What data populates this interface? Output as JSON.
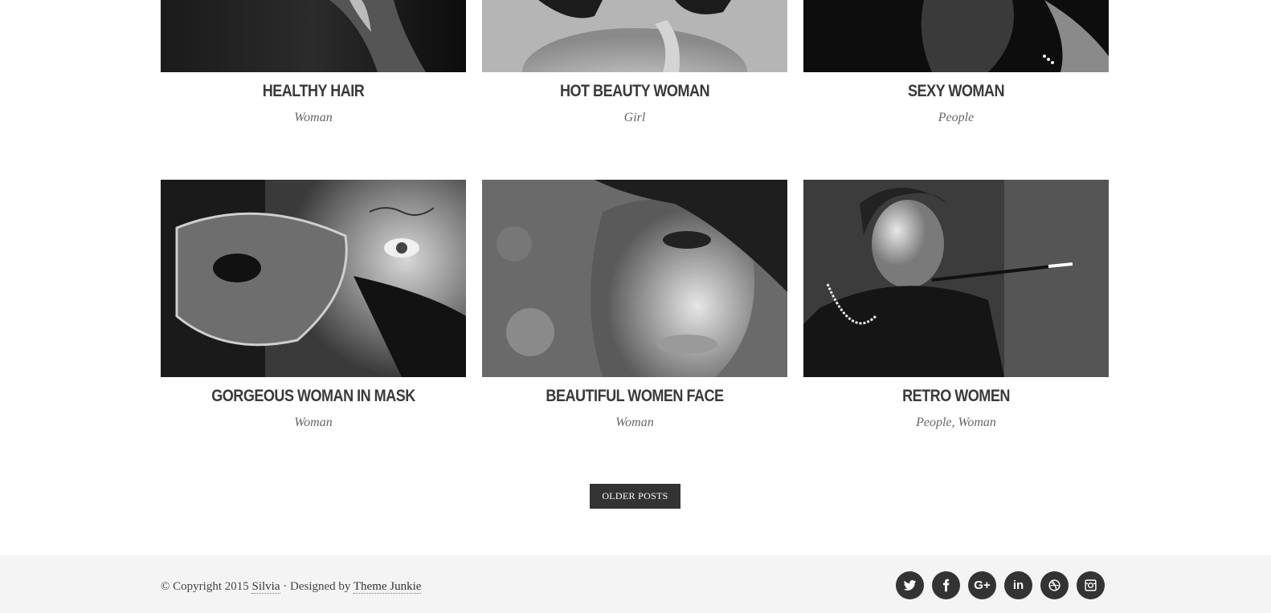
{
  "posts": [
    {
      "title": "HEALTHY HAIR",
      "categories": [
        "Woman"
      ]
    },
    {
      "title": "HOT BEAUTY WOMAN",
      "categories": [
        "Girl"
      ]
    },
    {
      "title": "SEXY WOMAN",
      "categories": [
        "People"
      ]
    },
    {
      "title": "GORGEOUS WOMAN IN MASK",
      "categories": [
        "Woman"
      ]
    },
    {
      "title": "BEAUTIFUL WOMEN FACE",
      "categories": [
        "Woman"
      ]
    },
    {
      "title": "RETRO WOMEN",
      "categories": [
        "People",
        "Woman"
      ]
    }
  ],
  "pagination": {
    "older_label": "OLDER POSTS"
  },
  "footer": {
    "copyright_prefix": "© Copyright 2015",
    "site_name": "Silvia",
    "designed_by_text": "· Designed by",
    "designer": "Theme Junkie",
    "social": [
      {
        "icon": "twitter-icon"
      },
      {
        "icon": "facebook-icon"
      },
      {
        "icon": "google-plus-icon",
        "label": "G+"
      },
      {
        "icon": "linkedin-icon",
        "label": "in"
      },
      {
        "icon": "dribbble-icon"
      },
      {
        "icon": "instagram-icon"
      }
    ]
  }
}
